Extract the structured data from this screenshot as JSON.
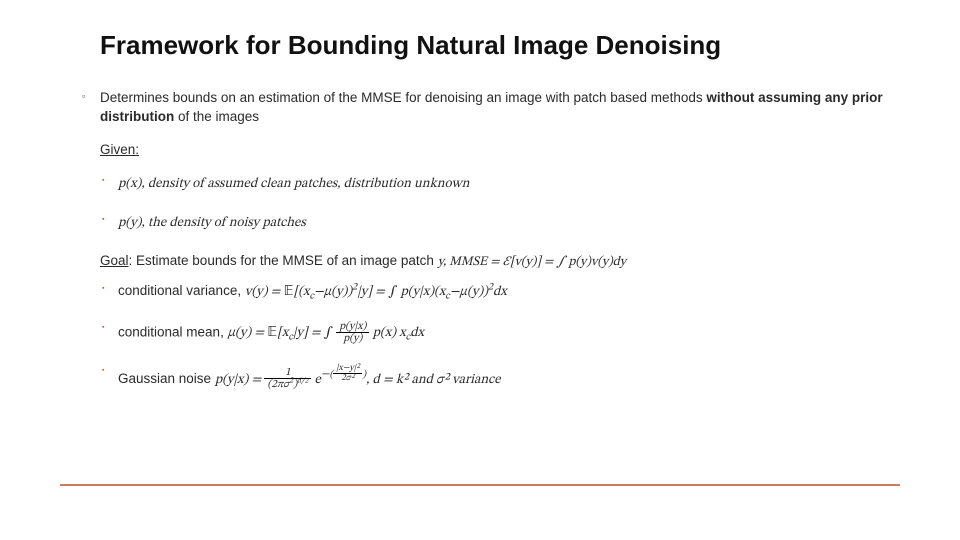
{
  "title": "Framework for Bounding Natural Image Denoising",
  "main_point_prefix": "Determines bounds on an estimation of the MMSE for denoising an image with patch based methods ",
  "main_point_bold": "without assuming any prior distribution",
  "main_point_suffix": " of the images",
  "given_label": "Given:",
  "given_items": {
    "g0": "p(x), density of assumed clean patches, distribution unknown",
    "g1": "p(y), the density of noisy patches"
  },
  "goal_label": "Goal",
  "goal_text": ": Estimate bounds for the MMSE of an image patch ",
  "goal_math": "y,  MMSE = ℰ[v(y)] = ∫ p(y)v(y)dy",
  "bullets": {
    "b0_prefix": "conditional variance, ",
    "b0_math": "v(y) = ℰ[(x_c−μ(y))²|y] = ∫ p(y|x)(x_c−μ(y))²dx",
    "b1_prefix": "conditional mean, ",
    "b1_math_part1": "μ(y) = ℰ[x_c|y] = ∫ ",
    "b1_frac_num": "p(y|x)",
    "b1_frac_den": "p(y)",
    "b1_math_part2": " p(x) x_c dx",
    "b2_prefix": "Gaussian noise ",
    "b2_lhs": "p(y|x) = ",
    "b2_frac1_num": "1",
    "b2_frac1_den_a": "(2πσ²)",
    "b2_frac1_den_exp": "d⁄2",
    "b2_e": "e",
    "b2_exp_prefix": "−",
    "b2_exp_num": "|x−y|²",
    "b2_exp_den": "2σ²",
    "b2_suffix": ", d = k² and σ² variance"
  }
}
